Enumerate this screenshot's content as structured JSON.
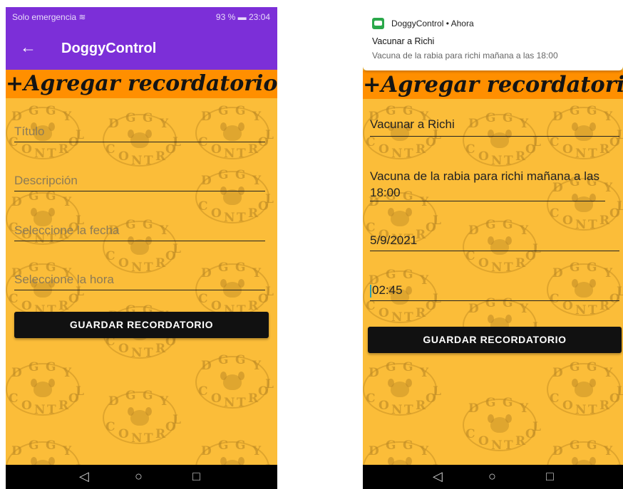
{
  "left_screen": {
    "status_bar": {
      "left": "Solo emergencia",
      "right": "93 %",
      "time": "23:04"
    },
    "app_bar": {
      "title": "DoggyControl"
    },
    "heading": "+Agregar recordatorio",
    "fields": {
      "title_placeholder": "Título",
      "description_placeholder": "Descripción",
      "date_placeholder": "Seleccione la fecha",
      "time_placeholder": "Seleccione la hora"
    },
    "save_button": "GUARDAR RECORDATORIO"
  },
  "right_screen": {
    "notification": {
      "app": "DoggyControl",
      "when": "Ahora",
      "title": "Vacunar a Richi",
      "text": "Vacuna de la rabia para richi mañana a las 18:00"
    },
    "heading": "+Agregar recordatorio",
    "fields": {
      "title_value": "Vacunar a Richi",
      "description_value": "Vacuna de la rabia para richi mañana a las 18:00",
      "date_value": "5/9/2021",
      "time_value": "02:45"
    },
    "save_button": "GUARDAR RECORDATORIO"
  },
  "watermark_letters": [
    "D",
    "G",
    "G",
    "Y",
    "C",
    "O",
    "N",
    "T",
    "R",
    "O",
    "L"
  ],
  "colors": {
    "background": "#fbbd39",
    "app_bar": "#7c2fd8",
    "banner": "#ff8f00",
    "button": "#111111"
  }
}
